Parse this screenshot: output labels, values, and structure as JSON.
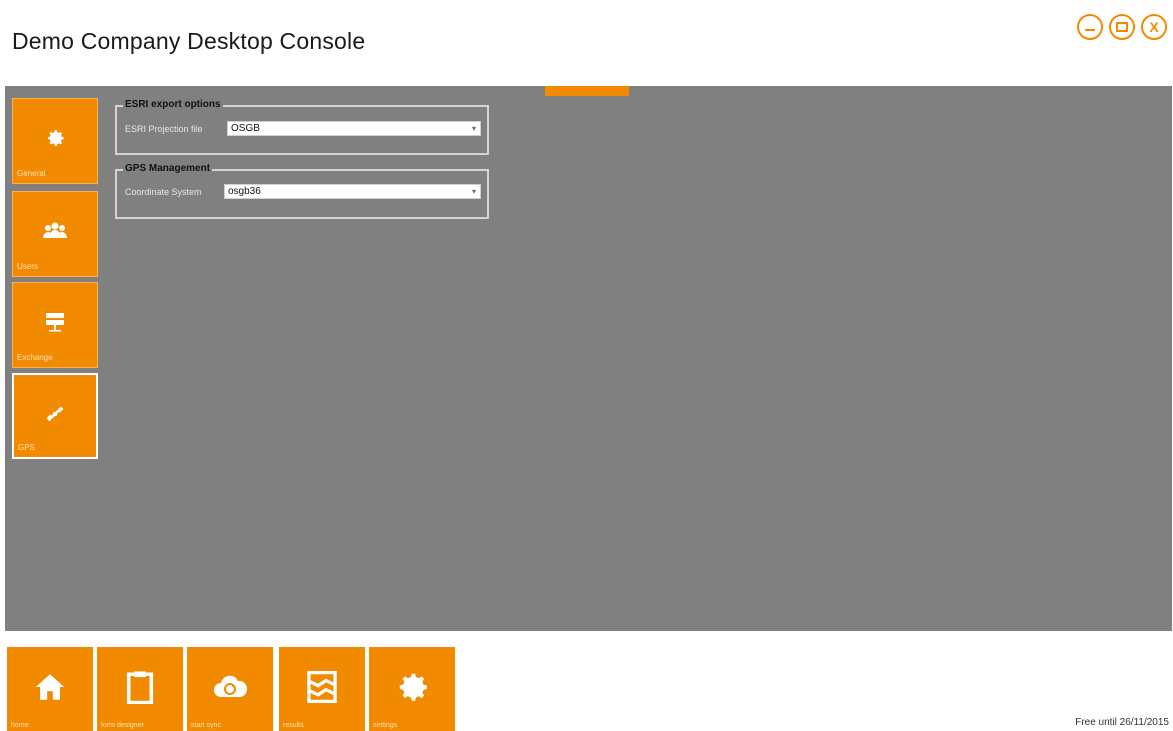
{
  "app": {
    "title": "Demo Company Desktop Console"
  },
  "window_controls": {
    "minimize_icon": "minimize-icon",
    "maximize_icon": "maximize-icon",
    "close_icon": "close-icon",
    "close_glyph": "X"
  },
  "colors": {
    "accent": "#f28a00",
    "panel_bg": "#808080",
    "background": "#ffffff"
  },
  "sidebar": {
    "items": [
      {
        "label": "General",
        "icon": "gear-icon"
      },
      {
        "label": "Users",
        "icon": "users-icon"
      },
      {
        "label": "Exchange",
        "icon": "exchange-icon"
      },
      {
        "label": "GPS",
        "icon": "gps-icon"
      }
    ],
    "selected": "GPS"
  },
  "esri": {
    "legend": "ESRI export options",
    "projection_label": "ESRI Projection file",
    "projection_value": "OSGB"
  },
  "gps": {
    "legend": "GPS Management",
    "coord_label": "Coordinate System",
    "coord_value": "osgb36"
  },
  "bottom_nav": {
    "items": [
      {
        "label": "home",
        "icon": "home-icon"
      },
      {
        "label": "form designer",
        "icon": "clipboard-icon"
      },
      {
        "label": "start sync",
        "icon": "cloud-sync-icon"
      },
      {
        "label": "results",
        "icon": "map-icon"
      },
      {
        "label": "settings",
        "icon": "gear-icon"
      }
    ]
  },
  "status": {
    "trial": "Free until 26/11/2015"
  }
}
